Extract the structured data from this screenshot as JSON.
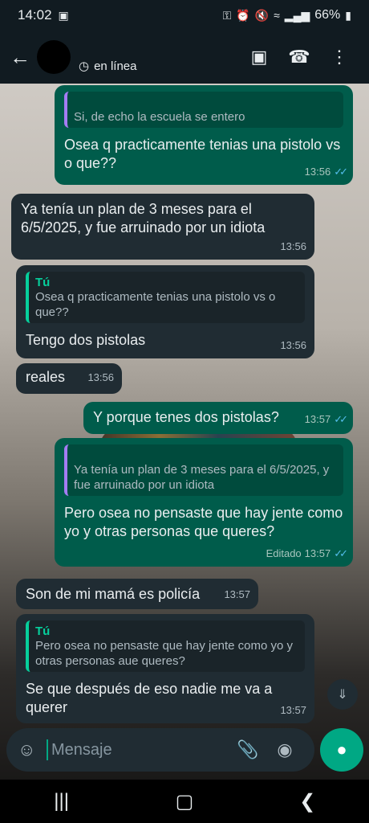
{
  "status_bar": {
    "time": "14:02",
    "battery": "66%"
  },
  "header": {
    "contact_name": "",
    "status": "en línea"
  },
  "messages": [
    {
      "dir": "out",
      "quote_author": "",
      "quote_text": "Si, de echo la escuela se entero",
      "text": "Osea q practicamente tenias una pistolo vs o que??",
      "time": "13:56",
      "read": true
    },
    {
      "dir": "in",
      "text": "Ya tenía un plan de 3 meses para el 6/5/2025, y fue arruinado por un idiota",
      "time": "13:56"
    },
    {
      "dir": "in",
      "quote_author": "Tú",
      "quote_text": "Osea q practicamente tenias una pistolo vs o que??",
      "text": "Tengo dos pistolas",
      "time": "13:56"
    },
    {
      "dir": "in",
      "text": "reales",
      "time": "13:56"
    },
    {
      "dir": "out",
      "text": "Y porque tenes dos pistolas?",
      "time": "13:57",
      "read": true
    },
    {
      "dir": "out",
      "quote_author": "",
      "quote_text": "Ya tenía un plan de 3 meses para el 6/5/2025, y fue arruinado por un idiota",
      "text": "Pero osea no pensaste que hay jente como yo y otras personas que queres?",
      "edited": "Editado",
      "time": "13:57",
      "read": true
    },
    {
      "dir": "in",
      "text": "Son de mi mamá es policía",
      "time": "13:57"
    },
    {
      "dir": "in",
      "quote_author": "Tú",
      "quote_text": "Pero osea no pensaste que hay jente como yo y otras personas aue queres?",
      "text": "Se que después de eso nadie me va a querer",
      "time": "13:57"
    }
  ],
  "composer": {
    "placeholder": "Mensaje"
  },
  "colors": {
    "outgoing": "#005c4b",
    "incoming": "#202c33",
    "accent": "#00a884",
    "read_ticks": "#53bdeb"
  }
}
